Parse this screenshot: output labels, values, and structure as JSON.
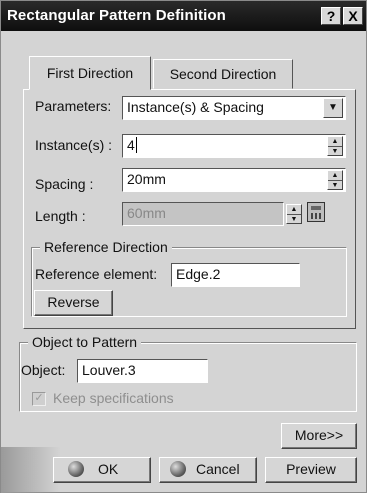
{
  "window": {
    "title": "Rectangular Pattern Definition",
    "help_glyph": "?",
    "close_glyph": "X"
  },
  "tabs": [
    {
      "label": "First Direction",
      "active": true
    },
    {
      "label": "Second Direction",
      "active": false
    }
  ],
  "parameters": {
    "label": "Parameters:",
    "value": "Instance(s) & Spacing",
    "arrow": "▼"
  },
  "instances": {
    "label": "Instance(s) :",
    "value": "4"
  },
  "spacing": {
    "label": "Spacing :",
    "value": "20mm"
  },
  "length": {
    "label": "Length :",
    "value": "60mm",
    "enabled": false
  },
  "spin": {
    "up": "▲",
    "down": "▼"
  },
  "reference_direction": {
    "title": "Reference Direction",
    "element_label": "Reference element:",
    "element_value": "Edge.2",
    "reverse_label": "Reverse"
  },
  "object_to_pattern": {
    "title": "Object to Pattern",
    "object_label": "Object:",
    "object_value": "Louver.3",
    "keep_spec_label": "Keep specifications",
    "keep_spec_checked": true,
    "check_glyph": "✓"
  },
  "footer": {
    "more_label": "More>>",
    "ok_label": "OK",
    "cancel_label": "Cancel",
    "preview_label": "Preview"
  }
}
